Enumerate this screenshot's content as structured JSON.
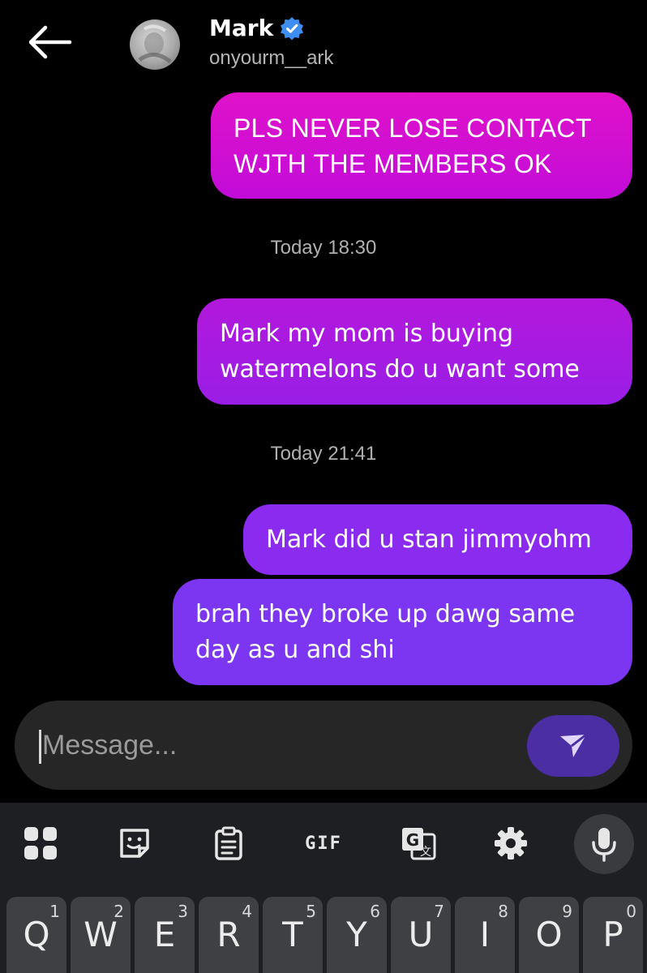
{
  "header": {
    "name": "Mark",
    "handle": "onyourm__ark",
    "icons": {
      "back": "arrow-left-icon",
      "verified": "verified-badge-icon"
    }
  },
  "messages": [
    {
      "text": "PLS NEVER LOSE CONTACT\nWJTH THE MEMBERS OK",
      "color": "#d40fd0"
    },
    {
      "text": "Mark my mom is buying\nwatermelons do u want some",
      "color": "#a81be0"
    },
    {
      "text": "Mark did u stan jimmyohm",
      "color": "#8b2bef"
    },
    {
      "text": "brah they broke up dawg same\nday as u and shi",
      "color": "#7c35f0"
    }
  ],
  "timestamps": [
    "Today 18:30",
    "Today 21:41"
  ],
  "composer": {
    "placeholder": "Message...",
    "value": "",
    "send_icon": "send-icon"
  },
  "keyboard": {
    "toolbar": [
      {
        "name": "apps-grid-icon"
      },
      {
        "name": "sticker-icon"
      },
      {
        "name": "clipboard-icon"
      },
      {
        "name": "gif-icon",
        "label": "GIF"
      },
      {
        "name": "translate-icon"
      },
      {
        "name": "settings-gear-icon"
      },
      {
        "name": "microphone-icon"
      }
    ],
    "row1": [
      {
        "letter": "Q",
        "num": "1"
      },
      {
        "letter": "W",
        "num": "2"
      },
      {
        "letter": "E",
        "num": "3"
      },
      {
        "letter": "R",
        "num": "4"
      },
      {
        "letter": "T",
        "num": "5"
      },
      {
        "letter": "Y",
        "num": "6"
      },
      {
        "letter": "U",
        "num": "7"
      },
      {
        "letter": "I",
        "num": "8"
      },
      {
        "letter": "O",
        "num": "9"
      },
      {
        "letter": "P",
        "num": "0"
      }
    ]
  },
  "colors": {
    "background": "#000000",
    "accent_verified": "#3d8ef0",
    "send_button": "#4b2ea4",
    "keyboard_bg": "#1e1f22"
  }
}
